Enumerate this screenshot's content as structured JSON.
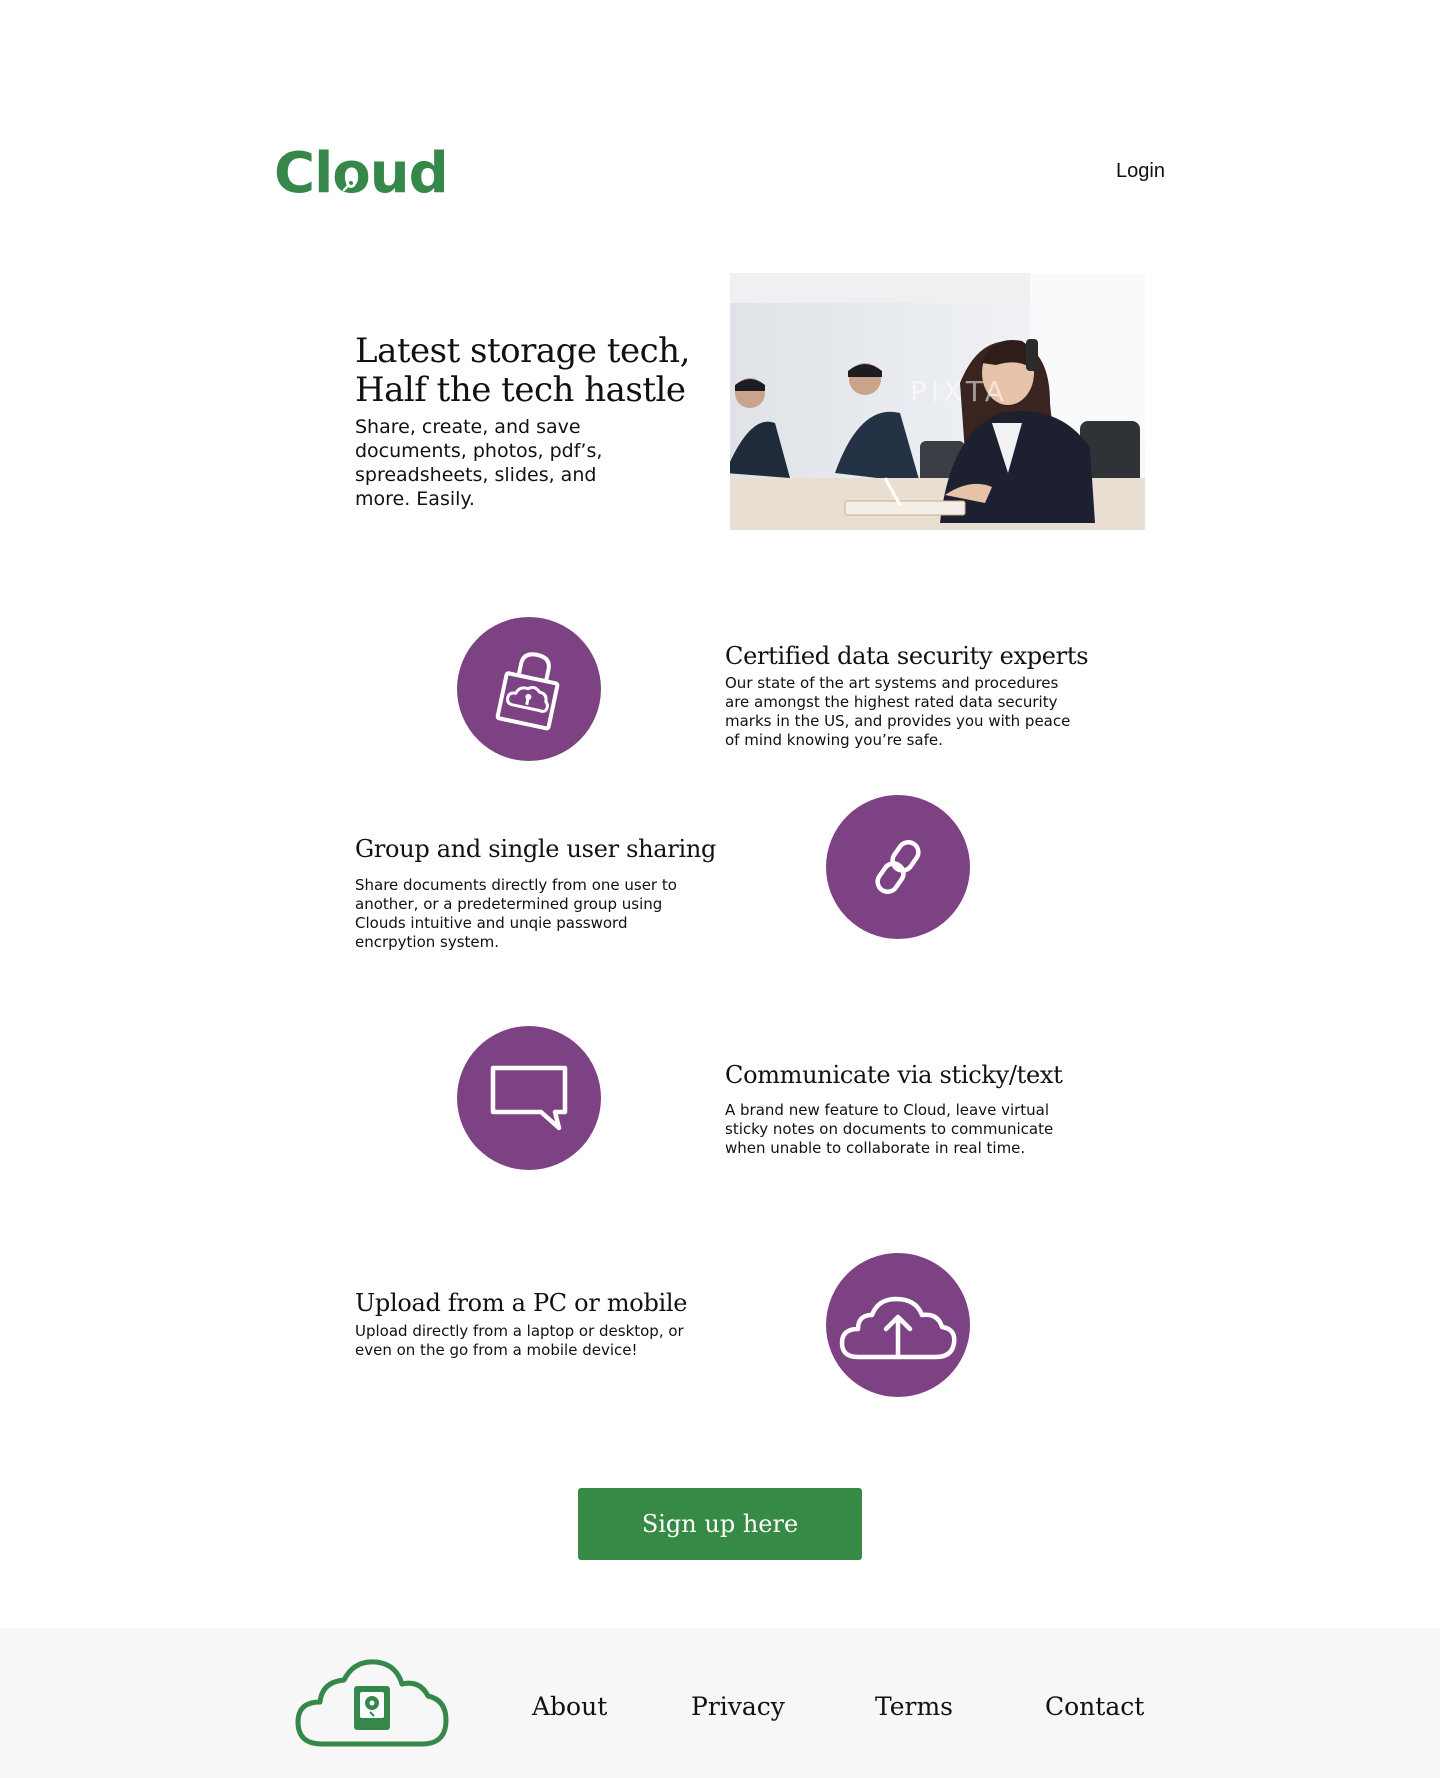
{
  "header": {
    "logo_text_before": "Cl",
    "logo_text_o": "o",
    "logo_text_after": "ud",
    "login_label": "Login"
  },
  "hero": {
    "title_line1": "Latest storage tech,",
    "title_line2": "Half the tech hastle",
    "subtitle": "Share, create, and save documents, photos, pdf’s, spreadsheets, slides, and more. Easily.",
    "photo_watermark": "PIXTA"
  },
  "features": [
    {
      "icon": "lock-cloud-icon",
      "title": "Certified data security experts",
      "text": "Our state of the art systems and procedures are amongst the highest rated data security marks in the US, and provides you with peace of mind knowing you’re safe."
    },
    {
      "icon": "link-icon",
      "title": "Group and single user sharing",
      "text": "Share documents directly from one user to another, or a predetermined group using Clouds intuitive and unqie password encrpytion system."
    },
    {
      "icon": "chat-bubble-icon",
      "title": "Communicate via sticky/text",
      "text": "A brand new feature to Cloud, leave virtual sticky notes on documents to communicate when unable to collaborate in real time."
    },
    {
      "icon": "cloud-upload-icon",
      "title": "Upload from a PC or mobile",
      "text": "Upload directly from a laptop or desktop, or even on the go from a mobile device!"
    }
  ],
  "cta": {
    "signup_label": "Sign up here"
  },
  "footer": {
    "links": [
      "About",
      "Privacy",
      "Terms",
      "Contact"
    ]
  },
  "colors": {
    "brand_green": "#35874a",
    "feature_purple": "#7d4283",
    "footer_bg": "#f7f7f7"
  }
}
